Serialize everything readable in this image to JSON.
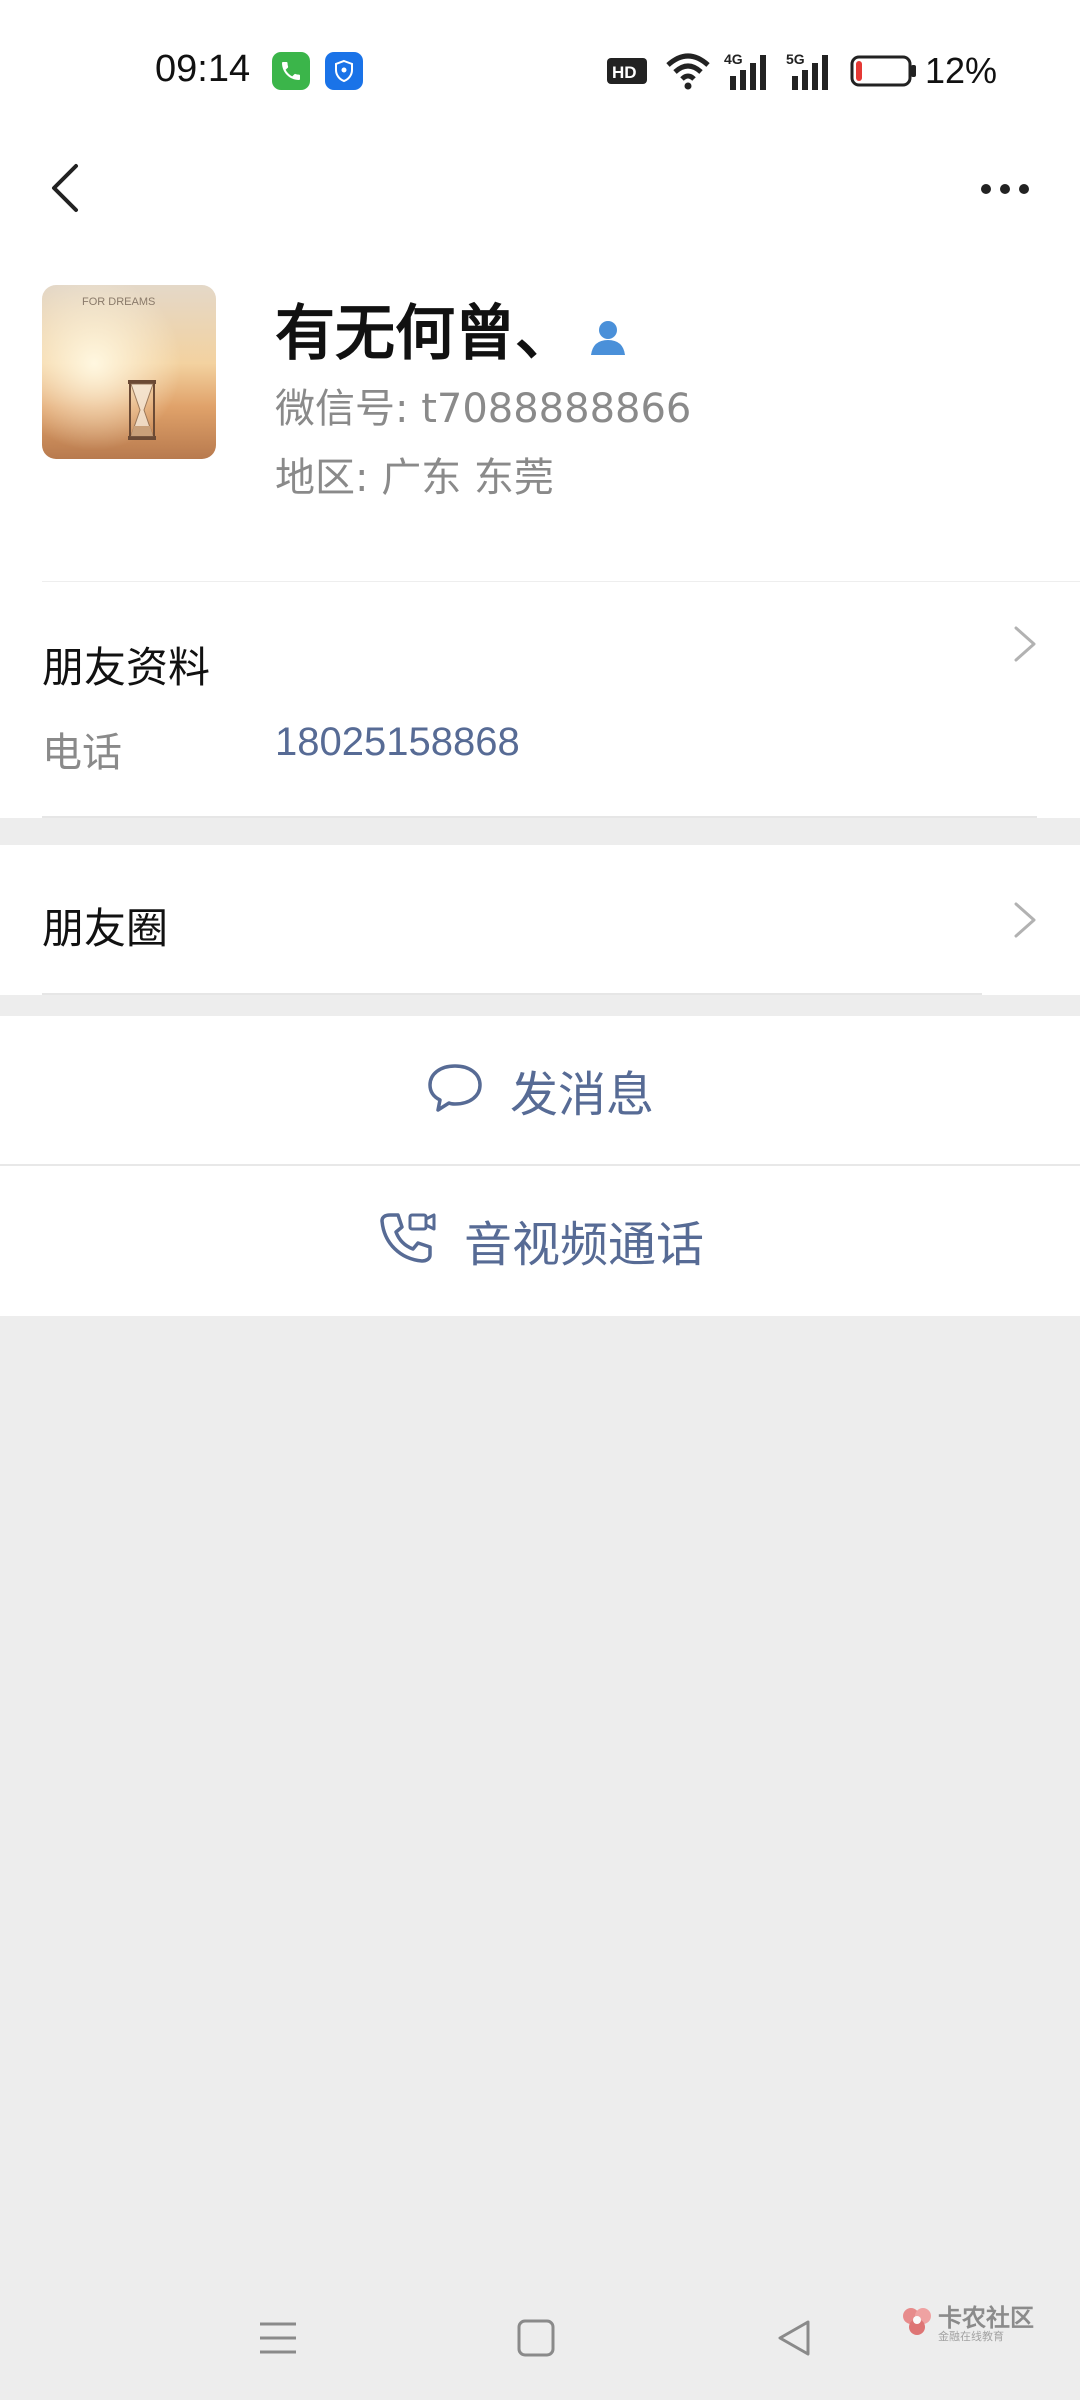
{
  "status_bar": {
    "time": "09:14",
    "battery_percent": "12%",
    "battery_level": 0.12,
    "network_1": "4G",
    "network_2": "5G",
    "hd_label": "HD",
    "icons": [
      "phone-app-icon",
      "shield-app-icon",
      "hd-icon",
      "wifi-icon",
      "signal-4g-icon",
      "signal-5g-icon",
      "battery-icon"
    ]
  },
  "header": {
    "back_icon": "chevron-left-icon",
    "more_icon": "more-dots-icon"
  },
  "profile": {
    "avatar_caption": "FOR DREAMS",
    "nickname": "有无何曾、",
    "wechat_id": "微信号: t7088888866",
    "region": "地区: 广东  东莞"
  },
  "friend_info": {
    "title": "朋友资料",
    "phone_label": "电话",
    "phone_value": "18025158868"
  },
  "moments": {
    "title": "朋友圈"
  },
  "actions": {
    "message": "发消息",
    "call": "音视频通话"
  },
  "watermark": {
    "main": "卡农社区",
    "sub": "金融在线教育"
  },
  "colors": {
    "link": "#576b95",
    "background": "#ededed",
    "secondary_text": "#8a8a8a"
  }
}
